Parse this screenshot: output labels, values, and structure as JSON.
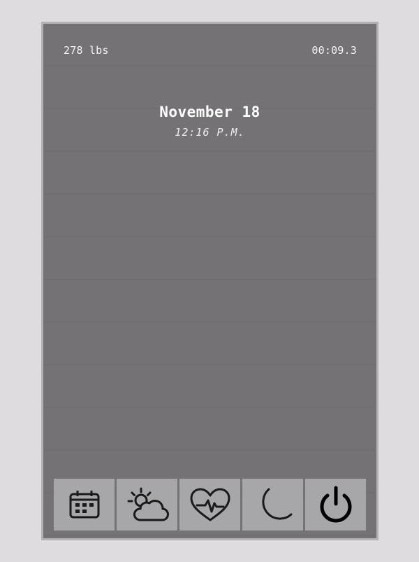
{
  "status": {
    "weight": "278 lbs",
    "timer": "00:09.3"
  },
  "clock": {
    "date": "November 18",
    "time": "12:16 P.M."
  },
  "dock": {
    "items": [
      {
        "icon": "calendar-icon"
      },
      {
        "icon": "weather-icon"
      },
      {
        "icon": "heart-rate-icon"
      },
      {
        "icon": "moon-icon"
      },
      {
        "icon": "power-icon"
      }
    ]
  },
  "colors": {
    "screen": "#747275",
    "bezel": "#b3b1b4",
    "dock_button": "#a7a6a8",
    "icon_stroke": "#1a1a1a"
  }
}
